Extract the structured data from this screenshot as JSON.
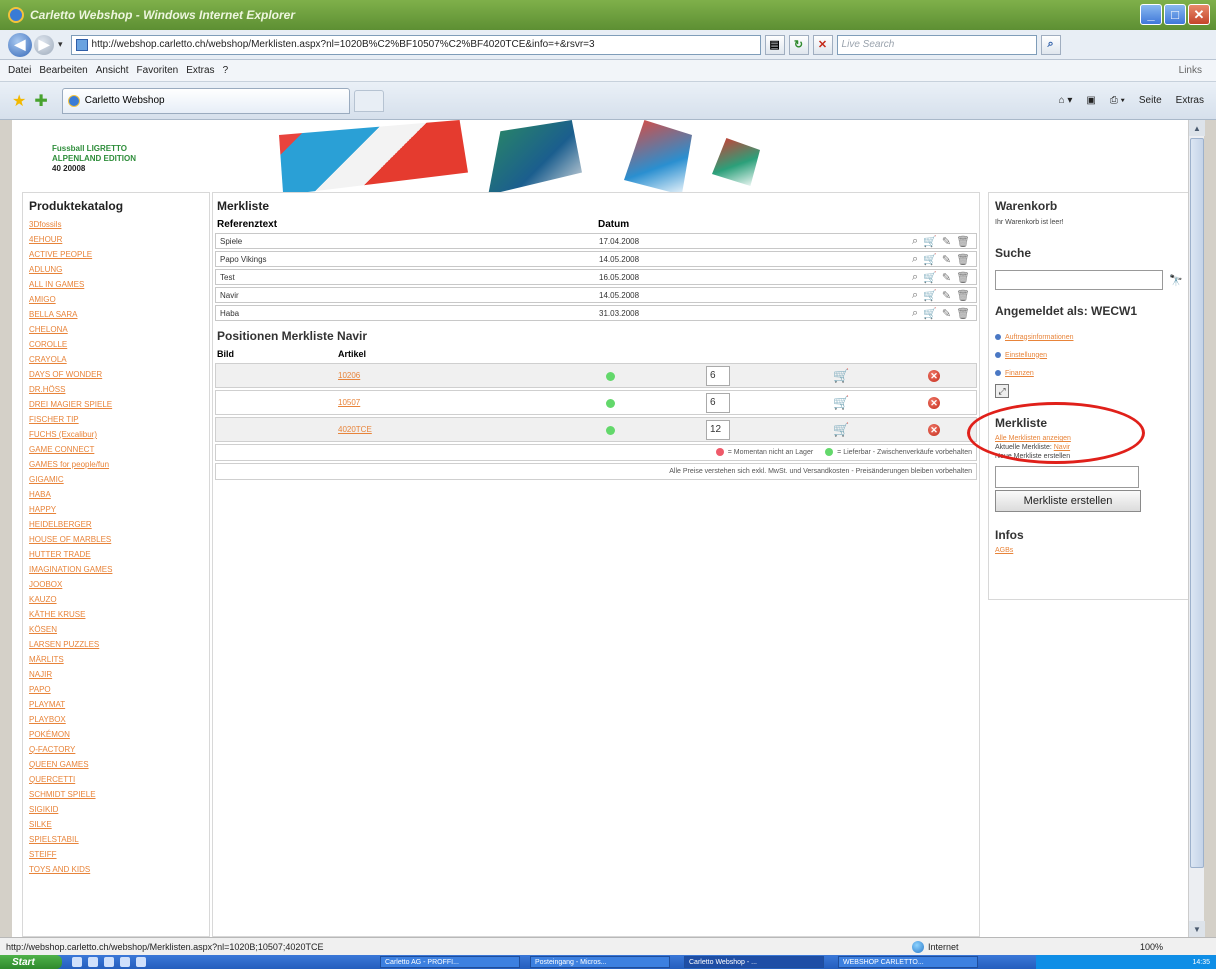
{
  "browser": {
    "title": "Carletto Webshop - Windows Internet Explorer",
    "url": "http://webshop.carletto.ch/webshop/Merklisten.aspx?nl=1020B%C2%BF10507%C2%BF4020TCE&info=+&rsvr=3",
    "search_placeholder": "Live Search",
    "menu": [
      "Datei",
      "Bearbeiten",
      "Ansicht",
      "Favoriten",
      "Extras",
      "?"
    ],
    "links_label": "Links",
    "tab_title": "Carletto Webshop",
    "command_bar": [
      "Seite",
      "Extras"
    ],
    "status_url": "http://webshop.carletto.ch/webshop/Merklisten.aspx?nl=1020B;10507;4020TCE",
    "status_zone": "Internet",
    "zoom": "100%"
  },
  "header": {
    "brand_line1": "Fussball LIGRETTO",
    "brand_line2": "ALPENLAND EDITION",
    "brand_number": "40 20008"
  },
  "catalog": {
    "title": "Produktekatalog",
    "items": [
      "3Dfossils",
      "4EHOUR",
      "ACTIVE PEOPLE",
      "ADLUNG",
      "ALL IN GAMES",
      "AMIGO",
      "BELLA SARA",
      "CHELONA",
      "COROLLE",
      "CRAYOLA",
      "DAYS OF WONDER",
      "DR.HÖSS",
      "DREI MAGIER SPIELE",
      "FISCHER TIP",
      "FUCHS (Excalibur)",
      "GAME CONNECT",
      "GAMES for people/fun",
      "GIGAMIC",
      "HABA",
      "HAPPY",
      "HEIDELBERGER",
      "HOUSE OF MARBLES",
      "HUTTER TRADE",
      "IMAGINATION GAMES",
      "JOOBOX",
      "KAUZO",
      "KÄTHE KRUSE",
      "KÖSEN",
      "LARSEN PUZZLES",
      "MÄRLITS",
      "NAJIR",
      "PAPO",
      "PLAYMAT",
      "PLAYBOX",
      "POKÉMON",
      "Q-FACTORY",
      "QUEEN GAMES",
      "QUERCETTI",
      "SCHMIDT SPIELE",
      "SIGIKID",
      "SILKE",
      "SPIELSTABIL",
      "STEIFF",
      "TOYS AND KIDS"
    ]
  },
  "merkliste": {
    "title": "Merkliste",
    "col_ref": "Referenztext",
    "col_date": "Datum",
    "rows": [
      {
        "ref": "Spiele",
        "date": "17.04.2008"
      },
      {
        "ref": "Papo Vikings",
        "date": "14.05.2008"
      },
      {
        "ref": "Test",
        "date": "16.05.2008"
      },
      {
        "ref": "Navir",
        "date": "14.05.2008"
      },
      {
        "ref": "Haba",
        "date": "31.03.2008"
      }
    ]
  },
  "positions": {
    "title": "Positionen Merkliste Navir",
    "col_image": "Bild",
    "col_article": "Artikel",
    "rows": [
      {
        "article": "10206",
        "qty": "6"
      },
      {
        "article": "10507",
        "qty": "6"
      },
      {
        "article": "4020TCE",
        "qty": "12"
      }
    ],
    "legend_red": "= Momentan nicht an Lager",
    "legend_green": "= Lieferbar - Zwischenverkäufe vorbehalten",
    "note": "Alle Preise verstehen sich exkl. MwSt. und Versandkosten - Preisänderungen bleiben vorbehalten"
  },
  "sidebar": {
    "cart_title": "Warenkorb",
    "cart_empty": "Ihr Warenkorb ist leer!",
    "search_title": "Suche",
    "logged_in_title": "Angemeldet als: WECW1",
    "account_links": [
      "Auftragsinformationen",
      "Einstellungen",
      "Finanzen"
    ],
    "merkliste_title": "Merkliste",
    "merkliste_show_all": "Alle Merklisten anzeigen",
    "current_label": "Aktuelle Merkliste:",
    "current_value": "Navir",
    "new_label": "Neue Merkliste erstellen",
    "create_button": "Merkliste erstellen",
    "info_title": "Infos",
    "info_link": "AGBs"
  },
  "taskbar": {
    "start": "Start",
    "tasks": [
      "Carletto AG - PROFFI...",
      "Posteingang - Micros...",
      "Carletto Webshop - ...",
      "WEBSHOP CARLETTO..."
    ],
    "clock": "14:35"
  },
  "colors": {
    "link": "#e8843a",
    "available": "#63d86b",
    "unavailable": "#ef5a6a",
    "highlight_circle": "#e0201a"
  }
}
